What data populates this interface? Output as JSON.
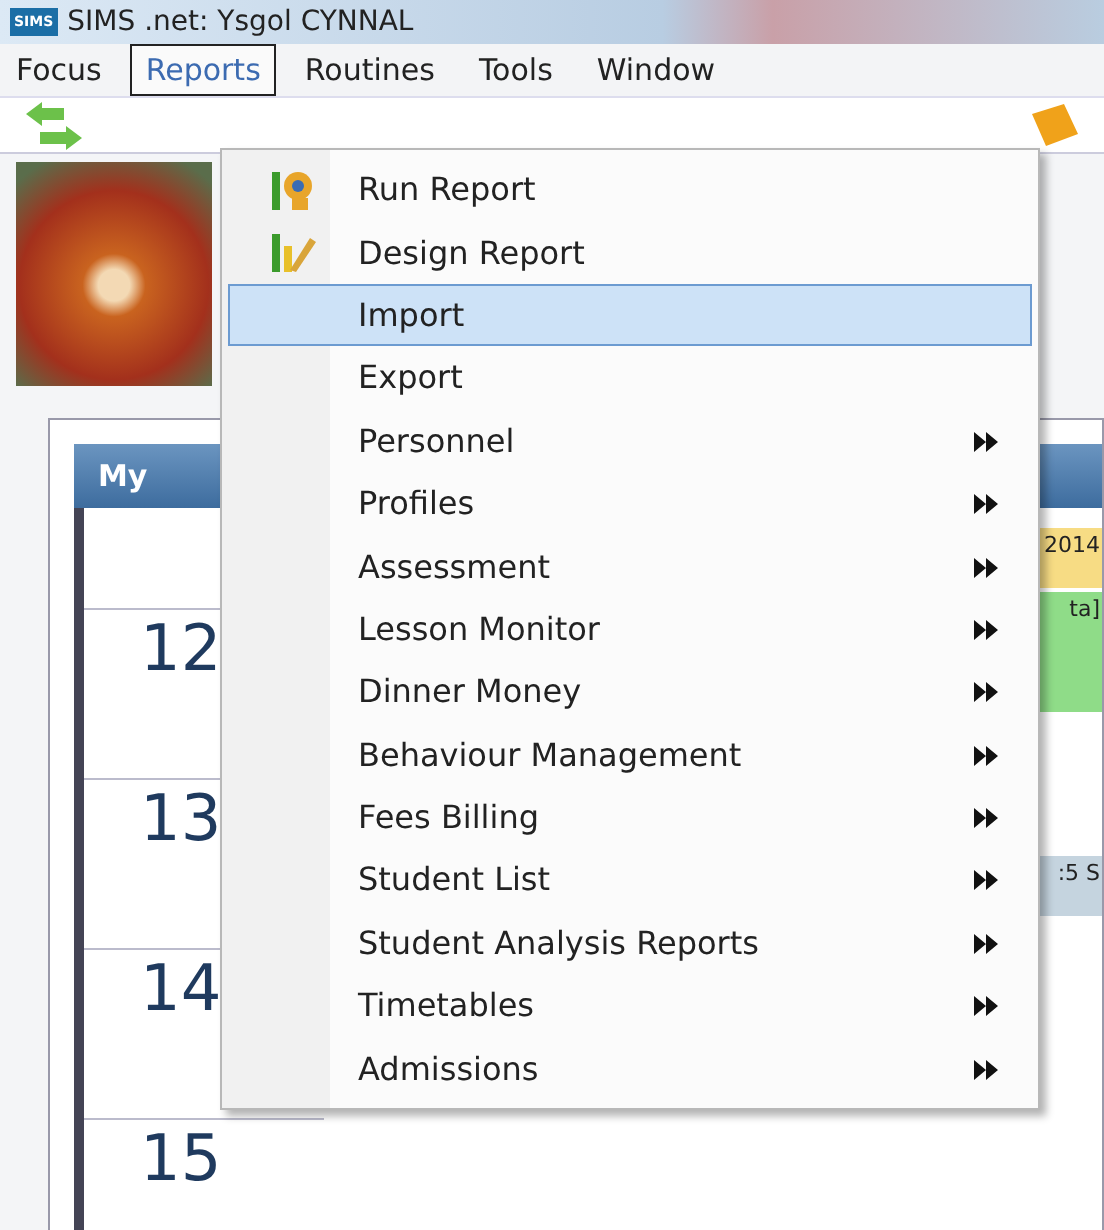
{
  "window": {
    "title": "SIMS .net: Ysgol CYNNAL",
    "logo": "SIMS"
  },
  "menubar": [
    {
      "label": "Focus",
      "selected": false
    },
    {
      "label": "Reports",
      "selected": true
    },
    {
      "label": "Routines",
      "selected": false
    },
    {
      "label": "Tools",
      "selected": false
    },
    {
      "label": "Window",
      "selected": false
    }
  ],
  "reports_menu": [
    {
      "label": "Run Report",
      "submenu": false,
      "selected": false
    },
    {
      "label": "Design Report",
      "submenu": false,
      "selected": false
    },
    {
      "label": "Import",
      "submenu": false,
      "selected": true
    },
    {
      "label": "Export",
      "submenu": false,
      "selected": false
    },
    {
      "label": "Personnel",
      "submenu": true,
      "selected": false
    },
    {
      "label": "Profiles",
      "submenu": true,
      "selected": false
    },
    {
      "label": "Assessment",
      "submenu": true,
      "selected": false
    },
    {
      "label": "Lesson Monitor",
      "submenu": true,
      "selected": false
    },
    {
      "label": "Dinner Money",
      "submenu": true,
      "selected": false
    },
    {
      "label": "Behaviour Management",
      "submenu": true,
      "selected": false
    },
    {
      "label": "Fees Billing",
      "submenu": true,
      "selected": false
    },
    {
      "label": "Student List",
      "submenu": true,
      "selected": false
    },
    {
      "label": "Student Analysis Reports",
      "submenu": true,
      "selected": false
    },
    {
      "label": "Timetables",
      "submenu": true,
      "selected": false
    },
    {
      "label": "Admissions",
      "submenu": true,
      "selected": false
    }
  ],
  "panel": {
    "title": "My",
    "hours": [
      "12",
      "13",
      "14",
      "15"
    ],
    "events": [
      {
        "text": "2014",
        "color": "#f7dc84"
      },
      {
        "text": "ta]",
        "color": "#8fdc88"
      },
      {
        "text": ":5 S",
        "color": "#c5d4df"
      }
    ]
  }
}
